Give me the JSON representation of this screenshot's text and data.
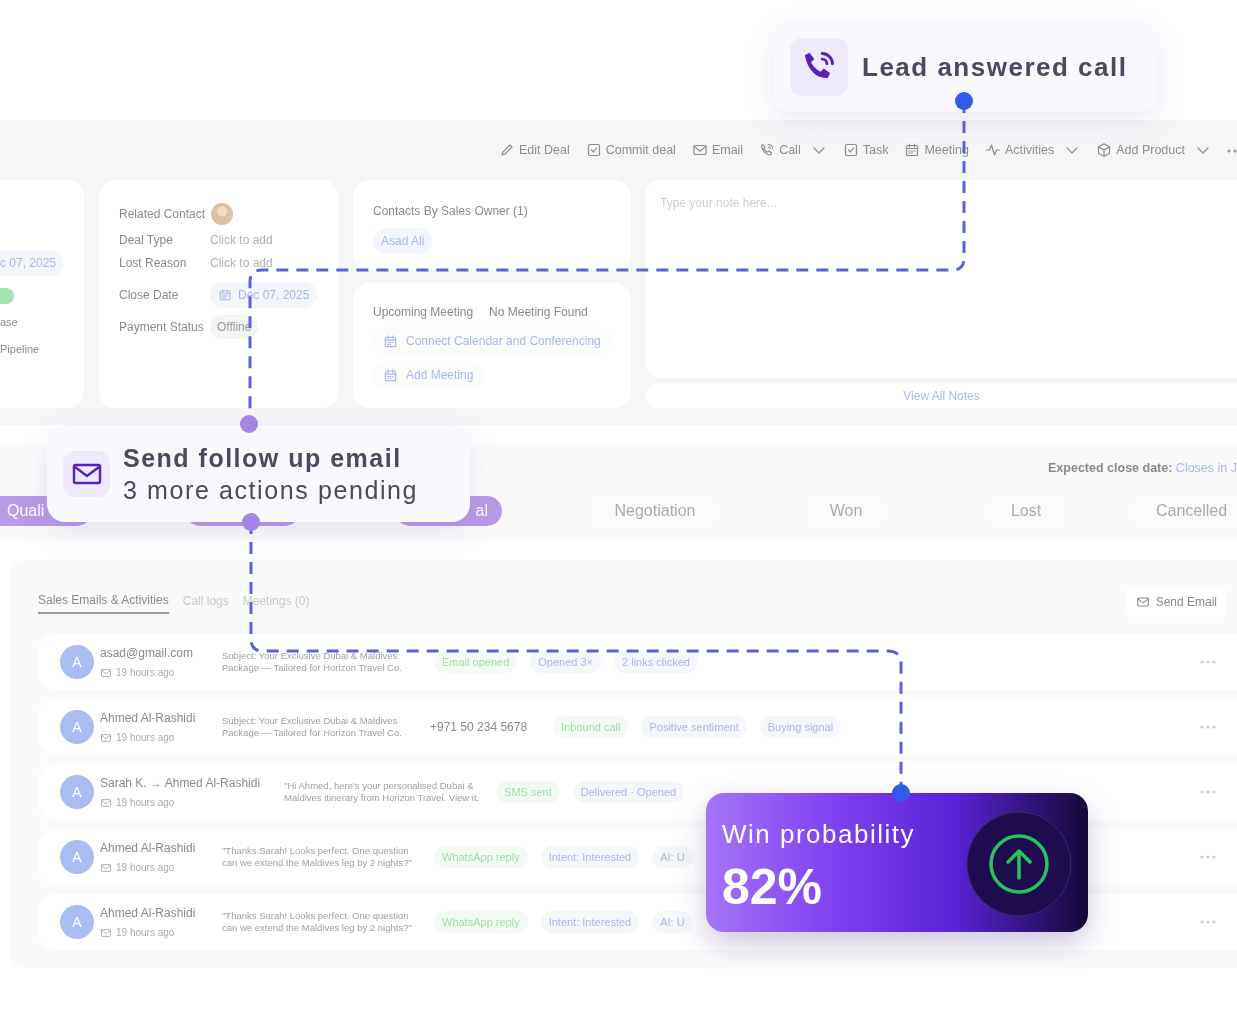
{
  "callouts": [
    {
      "kind": "call",
      "title": "Lead answered call"
    },
    {
      "kind": "email",
      "title": "Send follow up email",
      "subtitle": "3 more actions pending"
    }
  ],
  "toolbar": [
    {
      "kind": "pencil",
      "label": "Edit Deal",
      "dropdown": false
    },
    {
      "kind": "check",
      "label": "Commit deal",
      "dropdown": false
    },
    {
      "kind": "mail",
      "label": "Email",
      "dropdown": false
    },
    {
      "kind": "phone",
      "label": "Call",
      "dropdown": true
    },
    {
      "kind": "check",
      "label": "Task",
      "dropdown": false
    },
    {
      "kind": "calendar",
      "label": "Meeting",
      "dropdown": false
    },
    {
      "kind": "pulse",
      "label": "Activities",
      "dropdown": true
    },
    {
      "kind": "box",
      "label": "Add Product",
      "dropdown": true
    }
  ],
  "summary_card": {
    "date": "c 07, 2025",
    "stage": "ase",
    "pipeline": "Pipeline"
  },
  "deal_fields": [
    {
      "label": "Related Contact",
      "kind": "avatar"
    },
    {
      "label": "Deal Type",
      "kind": "empty",
      "value": "Click to add"
    },
    {
      "label": "Lost Reason",
      "kind": "empty",
      "value": "Click to add"
    },
    {
      "label": "Close Date",
      "kind": "date",
      "value": "Dec 07, 2025"
    },
    {
      "label": "Payment Status",
      "kind": "tag",
      "value": "Offline"
    }
  ],
  "contacts_card": {
    "title": "Contacts By Sales Owner (1)",
    "contacts": [
      "Asad Ali"
    ]
  },
  "meeting_card": {
    "label": "Upcoming Meeting",
    "status": "No Meeting Found",
    "actions": [
      "Connect Calendar and Conferencing",
      "Add Meeting"
    ]
  },
  "notes": {
    "placeholder": "Type your note here...",
    "link": "View All Notes"
  },
  "pipeline": {
    "expected_label": "Expected close date:",
    "expected_value": "Closes in J",
    "stages": [
      {
        "label": "Quali",
        "done": true
      },
      {
        "done": true
      },
      {
        "label": "al",
        "done": true
      },
      {
        "label": "Negotiation",
        "done": false
      },
      {
        "label": "Won",
        "done": false
      },
      {
        "label": "Lost",
        "done": false
      },
      {
        "label": "Cancelled",
        "done": false
      }
    ]
  },
  "activities": {
    "tabs": [
      {
        "label": "Sales Emails & Activities",
        "selected": true
      },
      {
        "label": "Call logs",
        "selected": false
      },
      {
        "label": "Meetings (0)",
        "selected": false
      }
    ],
    "send_button": "Send Email",
    "rows": [
      {
        "avatar": "A",
        "name": "asad@gmail.com",
        "time": "19 hours ago",
        "message": "Subject: Your Exclusive Dubai & Maldives Package — Tailored for Horizon Travel Co.",
        "tags": [
          {
            "kind": "channel",
            "text": "Email opened"
          },
          {
            "kind": "signal",
            "text": "Opened 3×"
          },
          {
            "kind": "signal",
            "text": "2 links clicked"
          }
        ]
      },
      {
        "avatar": "A",
        "name": "Ahmed Al-Rashidi",
        "time": "19 hours ago",
        "message": "Subject: Your Exclusive Dubai & Maldives Package — Tailored for Horizon Travel Co.",
        "phone": "+971 50 234 5678",
        "tags": [
          {
            "kind": "channel",
            "text": "Inbound call"
          },
          {
            "kind": "signal",
            "text": "Positive sentiment"
          },
          {
            "kind": "signal",
            "text": "Buying signal"
          }
        ]
      },
      {
        "avatar": "A",
        "name": "Sarah K. → Ahmed Al-Rashidi",
        "time": "19 hours ago",
        "message": "\"Hi Ahmed, here's your personalised Dubai & Maldives itinerary from Horizon Travel. View it.",
        "tags": [
          {
            "kind": "channel",
            "text": "SMS sent"
          },
          {
            "kind": "signal",
            "text": "Delivered · Opened"
          }
        ]
      },
      {
        "avatar": "A",
        "name": "Ahmed Al-Rashidi",
        "time": "19 hours ago",
        "message": "\"Thanks Sarah! Looks perfect. One question can we extend the Maldives leg by 2 nights?\"",
        "tags": [
          {
            "kind": "channel",
            "text": "WhatsApp reply"
          },
          {
            "kind": "signal",
            "text": "Intent: Interested"
          },
          {
            "kind": "signal",
            "text": "AI: U"
          }
        ]
      },
      {
        "avatar": "A",
        "name": "Ahmed Al-Rashidi",
        "time": "19 hours ago",
        "message": "\"Thanks Sarah! Looks perfect. One question can we extend the Maldives leg by 2 nights?\"",
        "tags": [
          {
            "kind": "channel",
            "text": "WhatsApp reply"
          },
          {
            "kind": "signal",
            "text": "Intent: Interested"
          },
          {
            "kind": "signal",
            "text": "AI: U"
          }
        ]
      }
    ]
  },
  "win_card": {
    "label": "Win probability",
    "value": "82%"
  }
}
